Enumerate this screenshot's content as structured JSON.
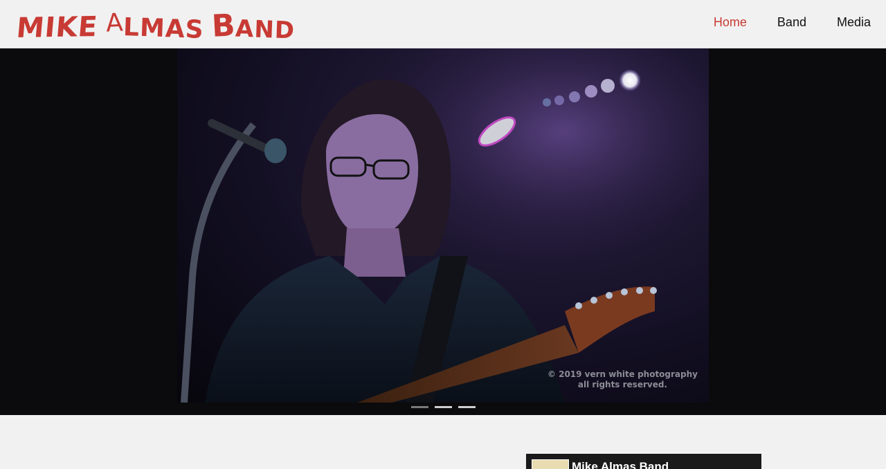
{
  "header": {
    "logo": {
      "mike": "MIKE",
      "a": "A",
      "lmas": "LMAS",
      "b": "B",
      "and": "AND"
    },
    "nav": [
      {
        "label": "Home",
        "active": true
      },
      {
        "label": "Band",
        "active": false
      },
      {
        "label": "Media",
        "active": false
      }
    ]
  },
  "hero": {
    "watermark_line1": "© 2019 vern white photography",
    "watermark_line2": "all rights reserved.",
    "slides_total": 3,
    "active_slide": 1
  },
  "facebook_widget": {
    "title": "Mike Almas Band"
  },
  "colors": {
    "brand": "#c83a34",
    "background": "#f1f1f1",
    "hero_bg": "#0b0a0c",
    "nav_text": "#111111"
  }
}
